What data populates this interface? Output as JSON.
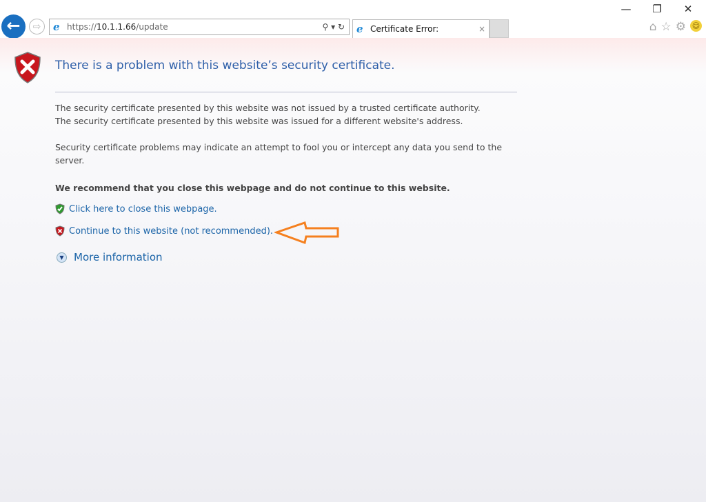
{
  "browser": {
    "address": {
      "scheme": "https://",
      "host": "10.1.1.66",
      "path": "/update"
    },
    "tab": {
      "title": "Certificate Error: Navigation...",
      "close": "×"
    },
    "window_controls": {
      "minimize": "—",
      "restore": "❐",
      "close": "✕"
    },
    "toolbar_icons": [
      "home-icon",
      "favorites-star-icon",
      "settings-gear-icon",
      "feedback-smiley-icon"
    ]
  },
  "content": {
    "title": "There is a problem with this website’s security certificate.",
    "line1": "The security certificate presented by this website was not issued by a trusted certificate authority.",
    "line2": "The security certificate presented by this website was issued for a different website's address.",
    "warning": "Security certificate problems may indicate an attempt to fool you or intercept any data you send to the server.",
    "recommend": "We recommend that you close this webpage and do not continue to this website.",
    "close_link": "Click here to close this webpage.",
    "continue_link": "Continue to this website (not recommended).",
    "more_info": "More information"
  },
  "colors": {
    "accent": "#2d5ea8",
    "link": "#1b64a8",
    "annotation_arrow": "#f5801f"
  }
}
